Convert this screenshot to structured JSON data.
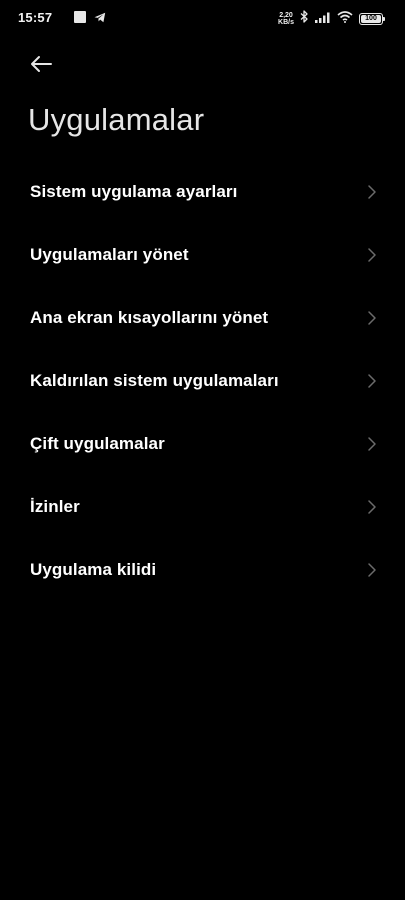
{
  "status_bar": {
    "time": "15:57",
    "net_speed_value": "2,20",
    "net_speed_unit": "KB/s",
    "battery": "100"
  },
  "header": {
    "title": "Uygulamalar"
  },
  "menu": {
    "items": [
      {
        "label": "Sistem uygulama ayarları"
      },
      {
        "label": "Uygulamaları yönet"
      },
      {
        "label": "Ana ekran kısayollarını yönet"
      },
      {
        "label": "Kaldırılan sistem uygulamaları"
      },
      {
        "label": "Çift uygulamalar"
      },
      {
        "label": "İzinler"
      },
      {
        "label": "Uygulama kilidi"
      }
    ]
  },
  "colors": {
    "background": "#000000",
    "text": "#ffffff",
    "chevron": "#6b6b6b"
  }
}
